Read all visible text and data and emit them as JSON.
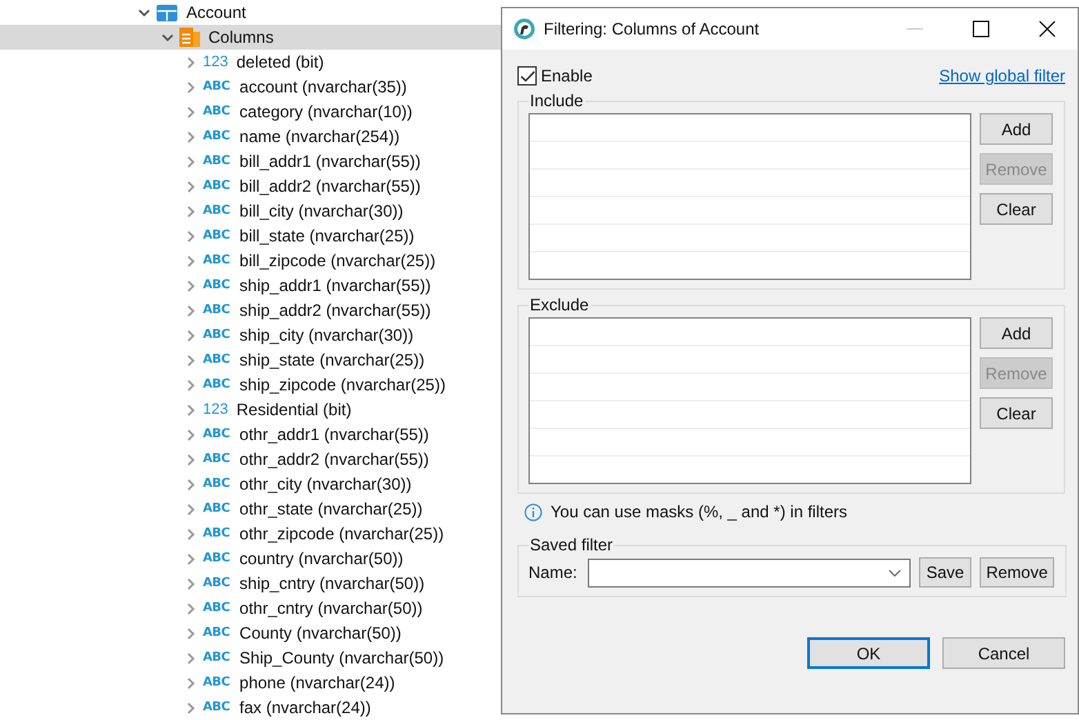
{
  "tree": [
    {
      "label": "Account",
      "kind": "table",
      "expanded": true,
      "selected": false,
      "children": [
        {
          "label": "Columns",
          "kind": "folder",
          "expanded": true,
          "selected": true,
          "children": [
            {
              "label": "deleted (bit)",
              "kind": "number",
              "type_icon": "123",
              "expanded": false,
              "selected": false
            },
            {
              "label": "account (nvarchar(35))",
              "kind": "text",
              "type_icon": "ABC",
              "expanded": false,
              "selected": false
            },
            {
              "label": "category (nvarchar(10))",
              "kind": "text",
              "type_icon": "ABC",
              "expanded": false,
              "selected": false
            },
            {
              "label": "name (nvarchar(254))",
              "kind": "text",
              "type_icon": "ABC",
              "expanded": false,
              "selected": false
            },
            {
              "label": "bill_addr1 (nvarchar(55))",
              "kind": "text",
              "type_icon": "ABC",
              "expanded": false,
              "selected": false
            },
            {
              "label": "bill_addr2 (nvarchar(55))",
              "kind": "text",
              "type_icon": "ABC",
              "expanded": false,
              "selected": false
            },
            {
              "label": "bill_city (nvarchar(30))",
              "kind": "text",
              "type_icon": "ABC",
              "expanded": false,
              "selected": false
            },
            {
              "label": "bill_state (nvarchar(25))",
              "kind": "text",
              "type_icon": "ABC",
              "expanded": false,
              "selected": false
            },
            {
              "label": "bill_zipcode (nvarchar(25))",
              "kind": "text",
              "type_icon": "ABC",
              "expanded": false,
              "selected": false
            },
            {
              "label": "ship_addr1 (nvarchar(55))",
              "kind": "text",
              "type_icon": "ABC",
              "expanded": false,
              "selected": false
            },
            {
              "label": "ship_addr2 (nvarchar(55))",
              "kind": "text",
              "type_icon": "ABC",
              "expanded": false,
              "selected": false
            },
            {
              "label": "ship_city (nvarchar(30))",
              "kind": "text",
              "type_icon": "ABC",
              "expanded": false,
              "selected": false
            },
            {
              "label": "ship_state (nvarchar(25))",
              "kind": "text",
              "type_icon": "ABC",
              "expanded": false,
              "selected": false
            },
            {
              "label": "ship_zipcode (nvarchar(25))",
              "kind": "text",
              "type_icon": "ABC",
              "expanded": false,
              "selected": false
            },
            {
              "label": "Residential (bit)",
              "kind": "number",
              "type_icon": "123",
              "expanded": false,
              "selected": false
            },
            {
              "label": "othr_addr1 (nvarchar(55))",
              "kind": "text",
              "type_icon": "ABC",
              "expanded": false,
              "selected": false
            },
            {
              "label": "othr_addr2 (nvarchar(55))",
              "kind": "text",
              "type_icon": "ABC",
              "expanded": false,
              "selected": false
            },
            {
              "label": "othr_city (nvarchar(30))",
              "kind": "text",
              "type_icon": "ABC",
              "expanded": false,
              "selected": false
            },
            {
              "label": "othr_state (nvarchar(25))",
              "kind": "text",
              "type_icon": "ABC",
              "expanded": false,
              "selected": false
            },
            {
              "label": "othr_zipcode (nvarchar(25))",
              "kind": "text",
              "type_icon": "ABC",
              "expanded": false,
              "selected": false
            },
            {
              "label": "country (nvarchar(50))",
              "kind": "text",
              "type_icon": "ABC",
              "expanded": false,
              "selected": false
            },
            {
              "label": "ship_cntry (nvarchar(50))",
              "kind": "text",
              "type_icon": "ABC",
              "expanded": false,
              "selected": false
            },
            {
              "label": "othr_cntry (nvarchar(50))",
              "kind": "text",
              "type_icon": "ABC",
              "expanded": false,
              "selected": false
            },
            {
              "label": "County (nvarchar(50))",
              "kind": "text",
              "type_icon": "ABC",
              "expanded": false,
              "selected": false
            },
            {
              "label": "Ship_County (nvarchar(50))",
              "kind": "text",
              "type_icon": "ABC",
              "expanded": false,
              "selected": false
            },
            {
              "label": "phone (nvarchar(24))",
              "kind": "text",
              "type_icon": "ABC",
              "expanded": false,
              "selected": false
            },
            {
              "label": "fax (nvarchar(24))",
              "kind": "text",
              "type_icon": "ABC",
              "expanded": false,
              "selected": false
            }
          ]
        }
      ]
    }
  ],
  "dialog": {
    "title": "Filtering: Columns of Account",
    "enable": {
      "label": "Enable",
      "checked": true
    },
    "global_filter_link": "Show global filter",
    "lists": [
      {
        "title": "Include",
        "buttons": [
          {
            "label": "Add",
            "disabled": false
          },
          {
            "label": "Remove",
            "disabled": true
          },
          {
            "label": "Clear",
            "disabled": false
          }
        ]
      },
      {
        "title": "Exclude",
        "buttons": [
          {
            "label": "Add",
            "disabled": false
          },
          {
            "label": "Remove",
            "disabled": true
          },
          {
            "label": "Clear",
            "disabled": false
          }
        ]
      }
    ],
    "hint": "You can use masks (%, _ and *) in filters",
    "saved_filter": {
      "title": "Saved filter",
      "name_label": "Name:",
      "buttons": [
        {
          "label": "Save",
          "disabled": false
        },
        {
          "label": "Remove",
          "disabled": false
        }
      ]
    },
    "buttons": [
      {
        "label": "OK",
        "default": true
      },
      {
        "label": "Cancel",
        "default": false
      }
    ]
  }
}
